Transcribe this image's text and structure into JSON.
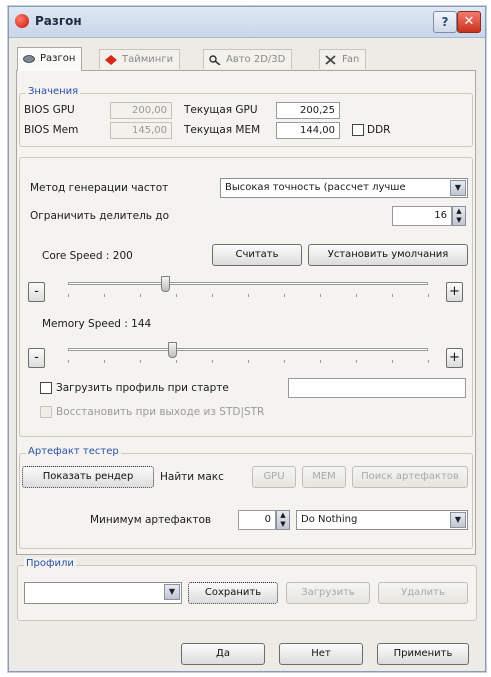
{
  "window": {
    "title": "Разгон",
    "help": "?",
    "close": "✕"
  },
  "tabs": [
    {
      "label": "Разгон",
      "icon": "overclock-icon",
      "active": true
    },
    {
      "label": "Тайминги",
      "icon": "timings-icon",
      "active": false
    },
    {
      "label": "Авто 2D/3D",
      "icon": "auto-2d3d-icon",
      "active": false
    },
    {
      "label": "Fan",
      "icon": "fan-tools-icon",
      "active": false
    }
  ],
  "values": {
    "title": "Значения",
    "bios_gpu_label": "BIOS GPU",
    "bios_gpu_value": "200,00",
    "current_gpu_label": "Текущая GPU",
    "current_gpu_value": "200,25",
    "bios_mem_label": "BIOS Mem",
    "bios_mem_value": "145,00",
    "current_mem_label": "Текущая MEM",
    "current_mem_value": "144,00",
    "ddr_label": "DDR"
  },
  "settings": {
    "freq_method_label": "Метод генерации частот",
    "freq_method_value": "Высокая точность (рассчет лучше",
    "divider_label": "Ограничить делитель до",
    "divider_value": "16",
    "core_speed_label": "Core Speed : 200",
    "read_button": "Считать",
    "defaults_button": "Установить умолчания",
    "core_slider_level": 0.27,
    "memory_speed_label": "Memory Speed : 144",
    "memory_slider_level": 0.29,
    "minus": "-",
    "plus": "+",
    "load_profile_label": "Загрузить профиль при старте",
    "restore_label": "Восстановить при выходе из STD|STR"
  },
  "artifact": {
    "title": "Артефакт тестер",
    "show_render_button": "Показать рендер",
    "find_max_label": "Найти макс",
    "gpu_button": "GPU",
    "mem_button": "MEM",
    "search_button": "Поиск артефактов",
    "min_artifacts_label": "Минимум артефактов",
    "min_artifacts_value": "0",
    "action_value": "Do Nothing"
  },
  "profiles": {
    "title": "Профили",
    "save_button": "Сохранить",
    "load_button": "Загрузить",
    "delete_button": "Удалить"
  },
  "footer": {
    "ok_button": "Да",
    "no_button": "Нет",
    "apply_button": "Применить"
  }
}
